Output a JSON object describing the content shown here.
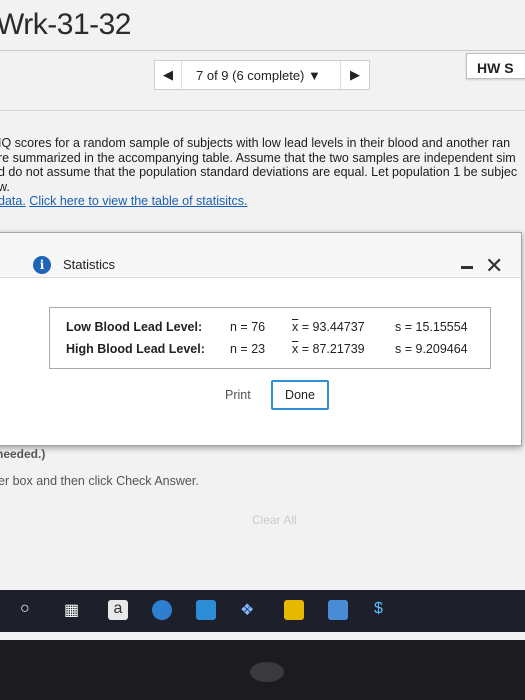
{
  "header": {
    "title": "Wrk-31-32",
    "hw_label": "HW S"
  },
  "nav": {
    "progress": "7 of 9 (6 complete)"
  },
  "problem": {
    "lines": [
      "IQ scores for a random sample of subjects with low lead levels in their blood and another ran",
      "re summarized in the accompanying table. Assume that the two samples are independent sim",
      "d do not assume that the population standard deviations are equal. Let population 1 be subjec",
      "w."
    ],
    "data_label": "data.",
    "link_label": "Click here to view the table of statisitcs."
  },
  "dialog": {
    "title": "Statistics",
    "rows": [
      {
        "label": "Low Blood Lead Level:",
        "n": "n = 76",
        "xbar": "x",
        "xval": " = 93.44737",
        "s": "s = 15.15554"
      },
      {
        "label": "High Blood Lead Level:",
        "n": "n = 23",
        "xbar": "x",
        "xval": " = 87.21739",
        "s": "s = 9.209464"
      }
    ],
    "print_label": "Print",
    "done_label": "Done"
  },
  "footer": {
    "needed": "needed.)",
    "instruction": "er box and then click Check Answer.",
    "clear_all": "Clear All"
  },
  "taskbar": {
    "icons": [
      "search-icon",
      "task-view-icon",
      "amazon-icon",
      "edge-icon",
      "photos-icon",
      "dropbox-icon",
      "store-icon",
      "mail-icon",
      "dollar-app-icon"
    ]
  }
}
